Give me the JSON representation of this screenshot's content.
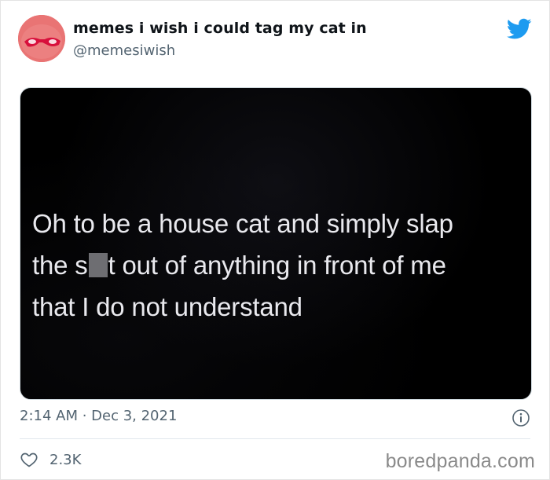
{
  "tweet": {
    "display_name": "memes i wish i could tag my cat in",
    "handle": "@memesiwish",
    "image_text": {
      "line1": "Oh to be a house cat and simply slap",
      "line2_before": "the s",
      "line2_after": "t out of anything in front of me",
      "line3": "that I do not understand"
    },
    "timestamp": "2:14 AM · Dec 3, 2021",
    "likes": "2.3K"
  },
  "watermark": "boredpanda.com",
  "icons": {
    "brand": "twitter-bird-icon",
    "info": "info-icon",
    "like": "heart-icon"
  },
  "colors": {
    "twitter_blue": "#1d9bf0",
    "secondary_text": "#536471",
    "primary_text": "#0f1419"
  }
}
